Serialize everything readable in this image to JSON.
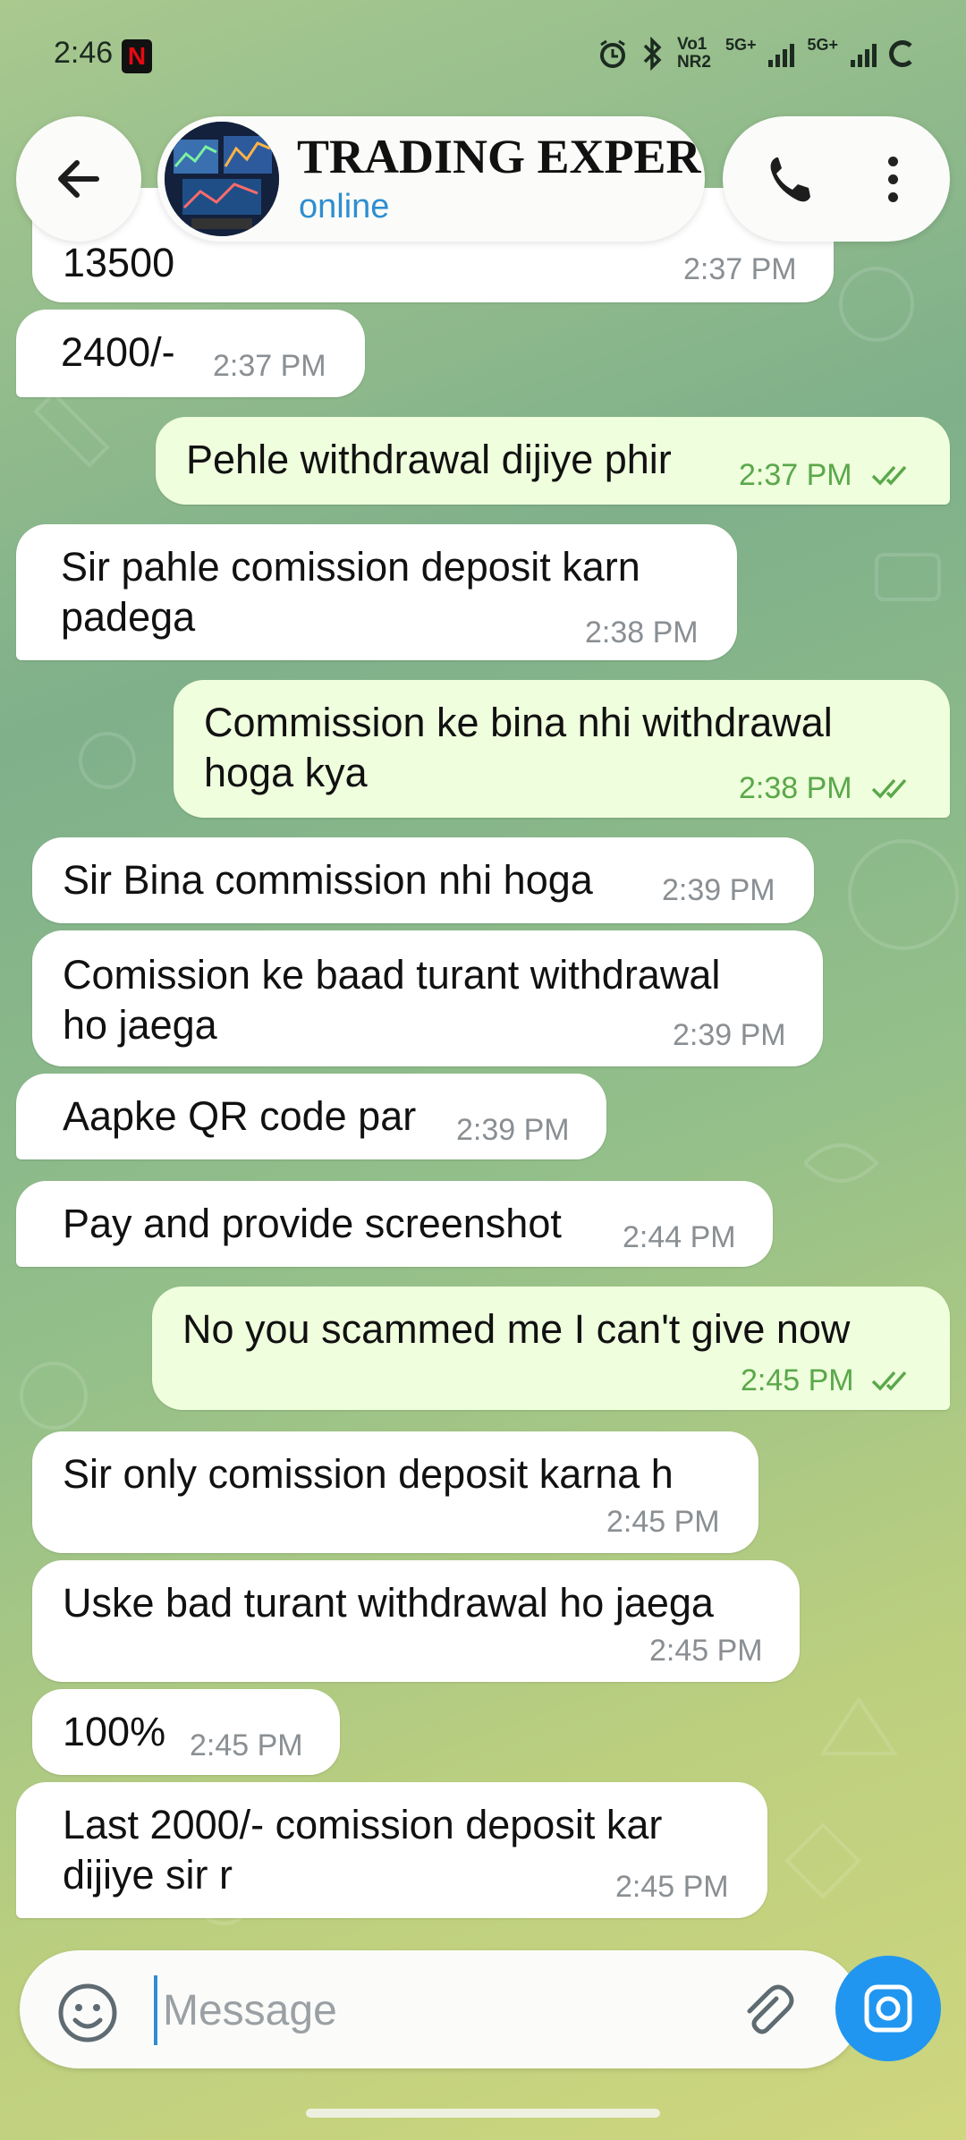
{
  "status_bar": {
    "time": "2:46",
    "network1": "Vo1 NR2",
    "network2": "5G+",
    "network3": "5G+"
  },
  "header": {
    "title": "TRADING EXPERT",
    "status": "online"
  },
  "messages": [
    {
      "dir": "in",
      "text": "13500",
      "time": "2:37 PM"
    },
    {
      "dir": "in",
      "text": "2400/-",
      "time": "2:37 PM"
    },
    {
      "dir": "out",
      "text": "Pehle withdrawal dijiye phir",
      "time": "2:37 PM"
    },
    {
      "dir": "in",
      "text1": "Sir pahle comission deposit karn",
      "text2": "padega",
      "time": "2:38 PM"
    },
    {
      "dir": "out",
      "text1": "Commission ke bina nhi withdrawal",
      "text2": "hoga kya",
      "time": "2:38 PM"
    },
    {
      "dir": "in",
      "text": "Sir Bina commission nhi hoga",
      "time": "2:39 PM"
    },
    {
      "dir": "in",
      "text1": "Comission ke baad turant withdrawal",
      "text2": "ho jaega",
      "time": "2:39 PM"
    },
    {
      "dir": "in",
      "text": "Aapke QR code par",
      "time": "2:39 PM"
    },
    {
      "dir": "in",
      "text": "Pay and provide screenshot",
      "time": "2:44 PM"
    },
    {
      "dir": "out",
      "text": "No you scammed me I can't give now",
      "time": "2:45 PM"
    },
    {
      "dir": "in",
      "text": "Sir only comission deposit karna h",
      "time": "2:45 PM"
    },
    {
      "dir": "in",
      "text": "Uske bad turant withdrawal ho jaega",
      "time": "2:45 PM"
    },
    {
      "dir": "in",
      "text": "100%",
      "time": "2:45 PM"
    },
    {
      "dir": "in",
      "text1": "Last 2000/- comission deposit kar",
      "text2": "dijiye sir r",
      "time": "2:45 PM"
    }
  ],
  "input": {
    "placeholder": "Message"
  },
  "icons": [
    "netflix-icon",
    "alarm-icon",
    "bluetooth-icon",
    "signal-icon",
    "battery-icon",
    "back-arrow-icon",
    "phone-icon",
    "more-vertical-icon",
    "emoji-icon",
    "attach-icon",
    "camera-icon",
    "double-check-icon"
  ],
  "colors": {
    "incoming_bubble": "#ffffff",
    "outgoing_bubble": "#effedd",
    "accent": "#2196f0",
    "online": "#2f8ed0",
    "read_ticks": "#5aa84a"
  }
}
